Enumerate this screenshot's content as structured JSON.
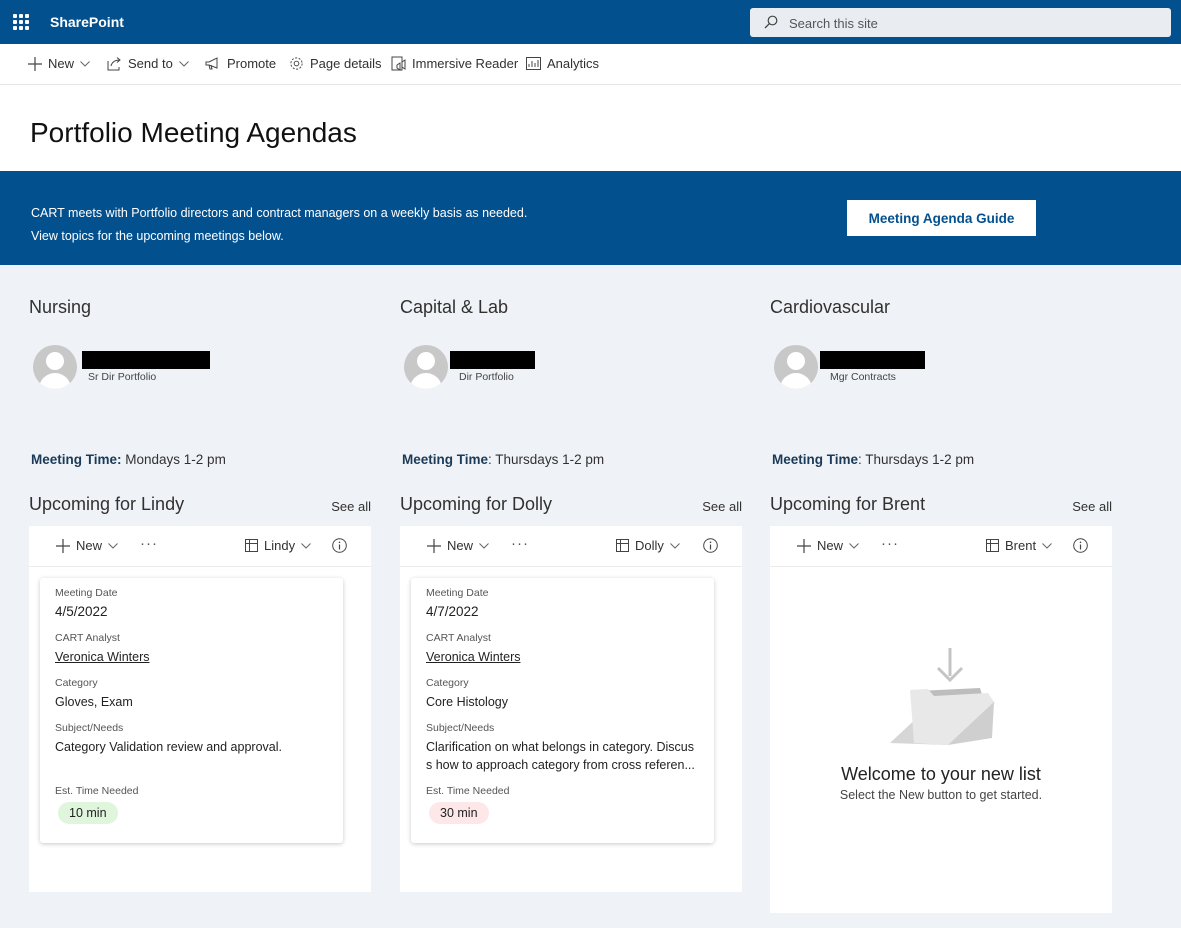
{
  "suitebar": {
    "app_name": "SharePoint",
    "search_placeholder": "Search this site"
  },
  "commands": [
    {
      "label": "New",
      "icon": "plus-icon",
      "dropdown": true
    },
    {
      "label": "Send to",
      "icon": "share-icon",
      "dropdown": true
    },
    {
      "label": "Promote",
      "icon": "megaphone-icon"
    },
    {
      "label": "Page details",
      "icon": "gear-icon"
    },
    {
      "label": "Immersive Reader",
      "icon": "immersive-reader-icon"
    },
    {
      "label": "Analytics",
      "icon": "analytics-icon"
    }
  ],
  "page": {
    "title": "Portfolio Meeting Agendas"
  },
  "banner": {
    "line1": "CART meets with Portfolio directors and contract managers on a weekly basis as needed.",
    "line2": "View topics for the upcoming meetings below.",
    "button_label": "Meeting Agenda Guide"
  },
  "columns": [
    {
      "title": "Nursing",
      "person_role": "Sr Dir Portfolio",
      "meeting_time_label": "Meeting Time:",
      "meeting_time_value": " Mondays 1-2 pm",
      "upcoming_title": "Upcoming for Lindy",
      "see_all": "See all",
      "toolbar": {
        "new_label": "New",
        "view_label": "Lindy"
      },
      "card": {
        "date_label": "Meeting Date",
        "date": "4/5/2022",
        "analyst_label": "CART Analyst",
        "analyst": "Veronica Winters",
        "category_label": "Category",
        "category": "Gloves, Exam",
        "subject_label": "Subject/Needs",
        "subject": "Category Validation review and approval.",
        "time_label": "Est. Time Needed",
        "time": "10 min",
        "time_color": "#dff6dd"
      }
    },
    {
      "title": "Capital & Lab",
      "person_role": "Dir Portfolio",
      "meeting_time_label": "Meeting Time",
      "meeting_time_value": ": Thursdays 1-2 pm",
      "upcoming_title": "Upcoming for Dolly",
      "see_all": "See all",
      "toolbar": {
        "new_label": "New",
        "view_label": "Dolly"
      },
      "card": {
        "date_label": "Meeting Date",
        "date": "4/7/2022",
        "analyst_label": "CART Analyst",
        "analyst": "Veronica Winters",
        "category_label": "Category",
        "category": "Core Histology",
        "subject_label": "Subject/Needs",
        "subject_line1": "Clarification on what belongs in category. Discus",
        "subject_line2": "s how to approach category from cross referen...",
        "time_label": "Est. Time Needed",
        "time": "30 min",
        "time_color": "#fde7e9"
      }
    },
    {
      "title": "Cardiovascular",
      "person_role": "Mgr Contracts",
      "meeting_time_label": "Meeting Time",
      "meeting_time_value": ": Thursdays 1-2 pm",
      "upcoming_title": "Upcoming for Brent",
      "see_all": "See all",
      "toolbar": {
        "new_label": "New",
        "view_label": "Brent"
      },
      "empty": {
        "title": "Welcome to your new list",
        "subtitle": "Select the New button to get started."
      }
    }
  ]
}
